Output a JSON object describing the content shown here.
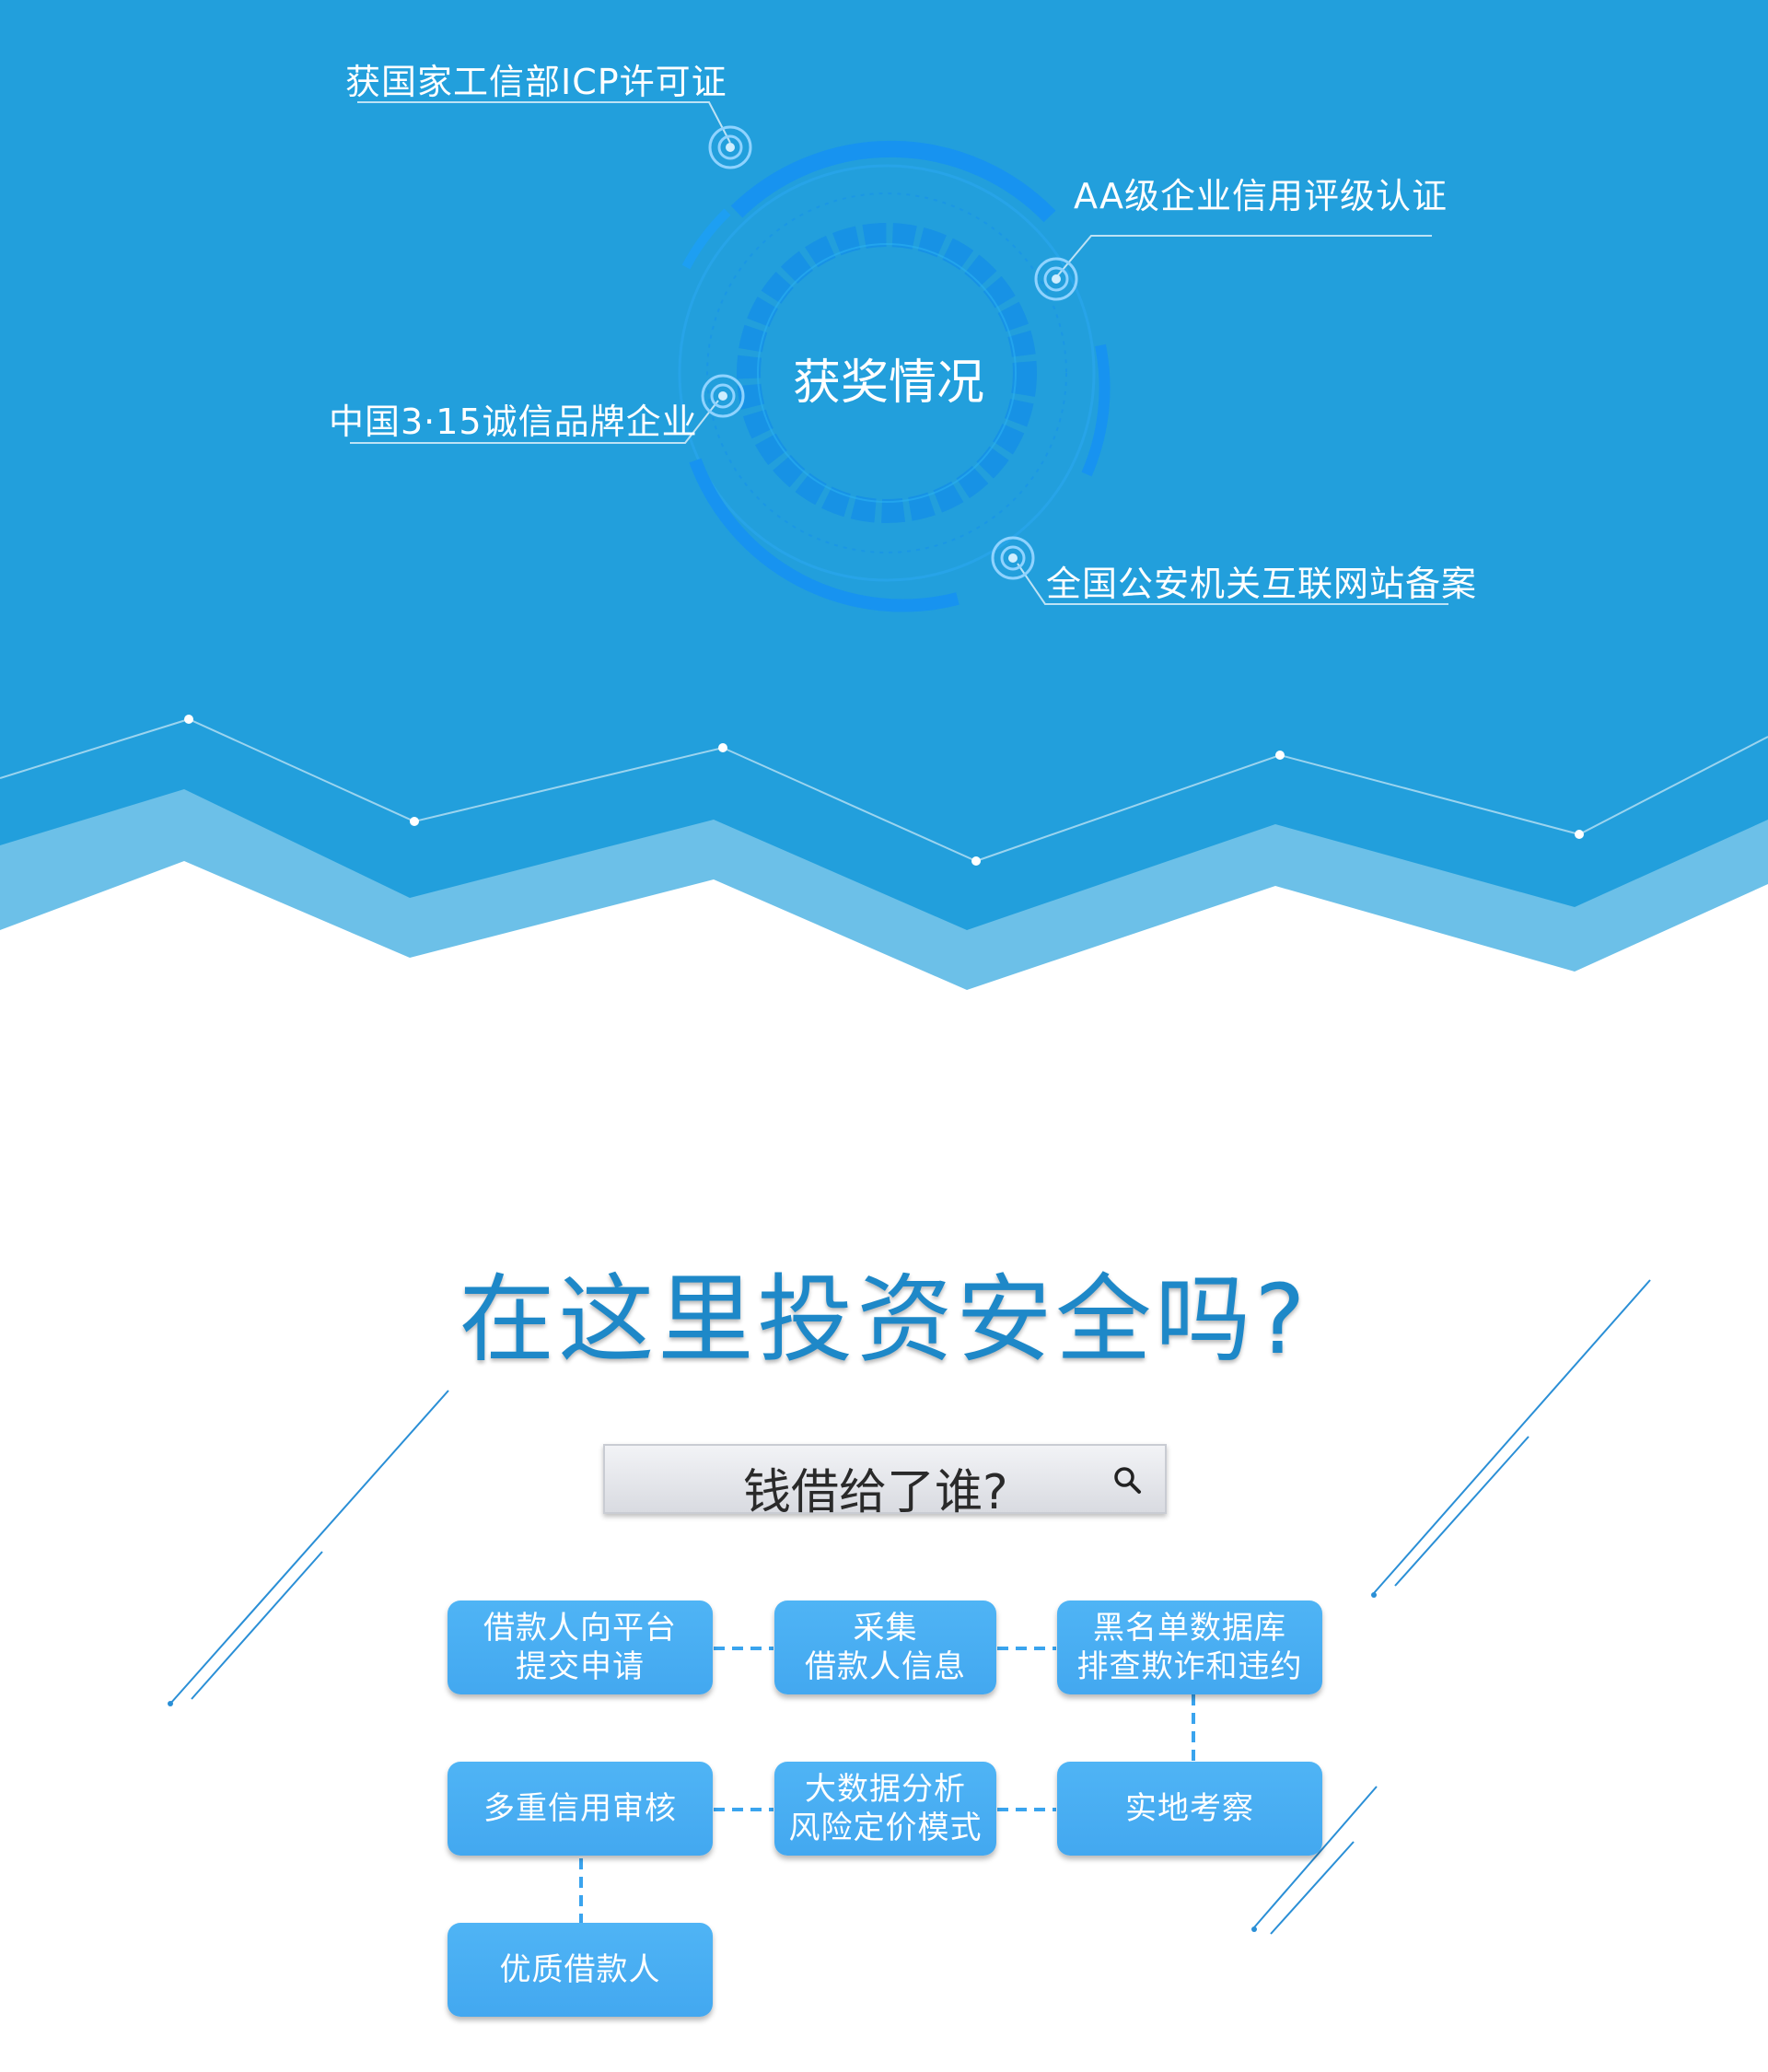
{
  "awards": {
    "center_title": "获奖情况",
    "items": [
      {
        "label": "获国家工信部ICP许可证"
      },
      {
        "label": "AA级企业信用评级认证"
      },
      {
        "label": "中国3·15诚信品牌企业"
      },
      {
        "label": "全国公安机关互联网站备案"
      }
    ]
  },
  "safety": {
    "title": "在这里投资安全吗?",
    "search": {
      "text": "钱借给了谁?",
      "icon": "search-icon"
    },
    "steps": [
      {
        "line1": "借款人向平台",
        "line2": "提交申请"
      },
      {
        "line1": "采集",
        "line2": "借款人信息"
      },
      {
        "line1": "黑名单数据库",
        "line2": "排查欺诈和违约"
      },
      {
        "line1": "实地考察",
        "line2": ""
      },
      {
        "line1": "大数据分析",
        "line2": "风险定价模式"
      },
      {
        "line1": "多重信用审核",
        "line2": ""
      },
      {
        "line1": "优质借款人",
        "line2": ""
      }
    ]
  },
  "colors": {
    "primary_blue": "#229fdc",
    "light_blue": "#6cc0e8",
    "title_blue": "#1e88c8",
    "box_blue": "#47acf2"
  }
}
